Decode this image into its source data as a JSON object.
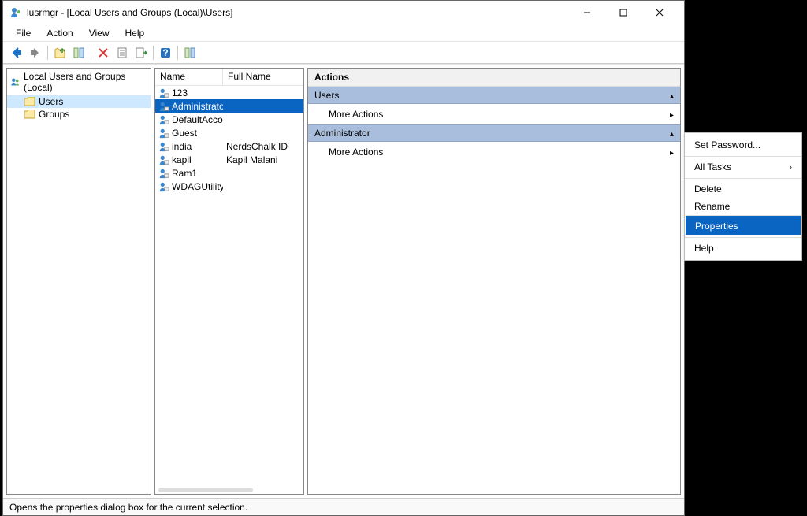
{
  "window": {
    "title": "lusrmgr - [Local Users and Groups (Local)\\Users]"
  },
  "menu": {
    "file": "File",
    "action": "Action",
    "view": "View",
    "help": "Help"
  },
  "tree": {
    "root": "Local Users and Groups (Local)",
    "users": "Users",
    "groups": "Groups"
  },
  "columns": {
    "name": "Name",
    "fullname": "Full Name"
  },
  "users": [
    {
      "name": "123",
      "fullname": ""
    },
    {
      "name": "Administrator",
      "fullname": ""
    },
    {
      "name": "DefaultAcco...",
      "fullname": ""
    },
    {
      "name": "Guest",
      "fullname": ""
    },
    {
      "name": "india",
      "fullname": "NerdsChalk ID"
    },
    {
      "name": "kapil",
      "fullname": "Kapil Malani"
    },
    {
      "name": "Ram1",
      "fullname": ""
    },
    {
      "name": "WDAGUtility...",
      "fullname": ""
    }
  ],
  "actions": {
    "header": "Actions",
    "group1": "Users",
    "more1": "More Actions",
    "group2": "Administrator",
    "more2": "More Actions"
  },
  "context": {
    "setpw": "Set Password...",
    "alltasks": "All Tasks",
    "delete": "Delete",
    "rename": "Rename",
    "properties": "Properties",
    "help": "Help"
  },
  "status": "Opens the properties dialog box for the current selection."
}
